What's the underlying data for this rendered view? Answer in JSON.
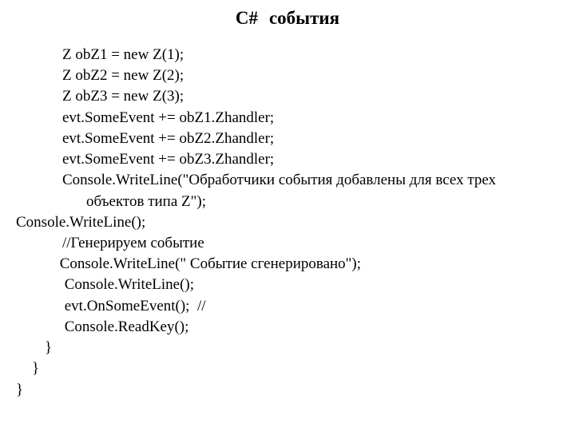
{
  "title": {
    "part1": "C#",
    "part2": "события"
  },
  "code": {
    "lines": [
      "Z obZ1 = new Z(1);",
      "Z obZ2 = new Z(2);",
      "Z obZ3 = new Z(3);",
      "evt.SomeEvent += obZ1.Zhandler;",
      "evt.SomeEvent += obZ2.Zhandler;",
      "evt.SomeEvent += obZ3.Zhandler;",
      "Console.WriteLine(\"Обработчики события добавлены для всех трех",
      "объектов типа Z\");",
      "Console.WriteLine();",
      "//Генерируем событие",
      " Console.WriteLine(\" Событие сгенерировано\");",
      " Console.WriteLine();",
      " evt.OnSomeEvent();  //",
      " Console.ReadKey();",
      "}",
      "}",
      "}"
    ]
  }
}
